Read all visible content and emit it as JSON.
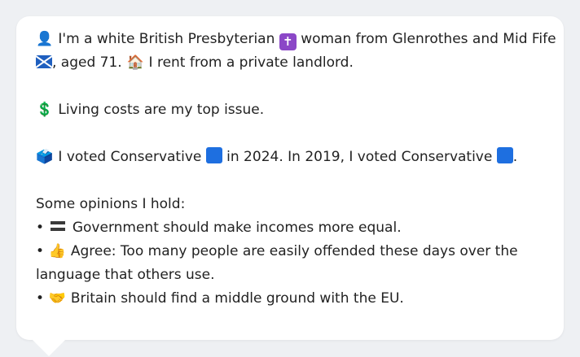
{
  "message": {
    "intro_part1": "I'm a white British Presbyterian",
    "intro_part2": "woman from Glenrothes and Mid Fife",
    "intro_part3": ", aged 71.",
    "intro_part4": "I rent from a private landlord.",
    "issue": "Living costs are my top issue.",
    "vote_part1": "I voted Conservative",
    "vote_part2": "in 2024. In 2019, I voted Conservative",
    "vote_part3": ".",
    "opinions_heading": "Some opinions I hold:",
    "bullet": "•",
    "opinion1": "Government should make incomes more equal.",
    "opinion2_line1": "Agree: Too many people are easily offended these days over the",
    "opinion2_line2": "language that others use.",
    "opinion3": "Britain should find a middle ground with the EU."
  },
  "icons": {
    "person": "👤",
    "cross": "✝",
    "house": "🏠",
    "dollar": "💲",
    "ballot": "🗳️",
    "thumbs": "👍",
    "handshake": "🤝"
  },
  "colors": {
    "background": "#eef0f3",
    "card": "#ffffff",
    "text": "#222222",
    "conservative_blue": "#1e6fe0",
    "cross_purple": "#8b47c7"
  }
}
